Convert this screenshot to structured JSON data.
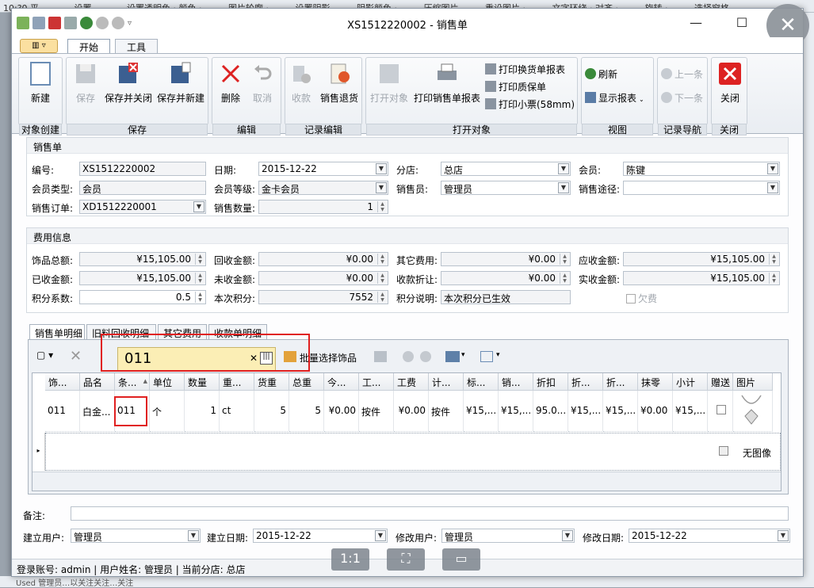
{
  "bg": {
    "strip": [
      "10:?0 平…",
      "设置…",
      "设置透明色 · 颜色 ·",
      "图片轮廓 ·",
      "设置阴影",
      "阴影颜色 ·",
      "压缩图片",
      "重设图片 ·",
      "文字环绕 · 对齐 ·",
      "旋转 ·",
      "选择窗格"
    ],
    "bottom": "Used  管理员…以关注关注…关注"
  },
  "window": {
    "title": "XS1512220002 - 销售单",
    "min": "—",
    "max": "☐",
    "close": "✕"
  },
  "ribbon": {
    "file_label": "▥ ▿",
    "tabs": [
      "开始",
      "工具"
    ],
    "groups": {
      "create": "对象创建",
      "save": "保存",
      "edit": "编辑",
      "record": "记录编辑",
      "open": "打开对象",
      "view": "视图",
      "nav": "记录导航",
      "close": "关闭"
    },
    "buttons": {
      "new": "新建",
      "save": "保存",
      "save_close": "保存并关闭",
      "save_new": "保存并新建",
      "delete": "删除",
      "cancel": "取消",
      "receive": "收款",
      "return": "销售退货",
      "open_obj": "打开对象",
      "print_report": "打印销售单报表",
      "print_exchange": "打印换货单报表",
      "print_quality": "打印质保单",
      "print_ticket": "打印小票(58mm)",
      "refresh": "刷新",
      "show_report": "显示报表",
      "prev": "上一条",
      "next": "下一条",
      "close": "关闭"
    }
  },
  "sales": {
    "heading": "销售单",
    "labels": {
      "no": "编号:",
      "date": "日期:",
      "branch": "分店:",
      "member": "会员:",
      "member_type": "会员类型:",
      "member_level": "会员等级:",
      "seller": "销售员:",
      "channel": "销售途径:",
      "order": "销售订单:",
      "qty": "销售数量:"
    },
    "values": {
      "no": "XS1512220002",
      "date": "2015-12-22",
      "branch": "总店",
      "member": "陈键",
      "member_type": "会员",
      "member_level": "金卡会员",
      "seller": "管理员",
      "channel": "",
      "order": "XD1512220001",
      "qty": "1"
    }
  },
  "fee": {
    "heading": "费用信息",
    "labels": {
      "total": "饰品总额:",
      "recycle": "回收金额:",
      "other": "其它费用:",
      "due": "应收金额:",
      "received": "已收金额:",
      "unreceived": "未收金额:",
      "discount": "收款折让:",
      "actual": "实收金额:",
      "factor": "积分系数:",
      "points": "本次积分:",
      "points_note": "积分说明:",
      "owe": "欠费"
    },
    "values": {
      "total": "¥15,105.00",
      "recycle": "¥0.00",
      "other": "¥0.00",
      "due": "¥15,105.00",
      "received": "¥15,105.00",
      "unreceived": "¥0.00",
      "discount": "¥0.00",
      "actual": "¥15,105.00",
      "factor": "0.5",
      "points": "7552",
      "points_note": "本次积分已生效"
    }
  },
  "detail_tabs": [
    "销售单明细",
    "旧料回收明细",
    "其它费用",
    "收款单明细"
  ],
  "toolbar": {
    "search": "011",
    "batch": "批量选择饰品"
  },
  "grid": {
    "headers": [
      "饰...",
      "品名",
      "条...",
      "单位",
      "数量",
      "重...",
      "货重",
      "总重",
      "今...",
      "工...",
      "工费",
      "计...",
      "标...",
      "销...",
      "折扣",
      "折...",
      "折...",
      "抹零",
      "小计",
      "赠送",
      "图片"
    ],
    "row": [
      "011",
      "白金...",
      "011",
      "个",
      "1",
      "ct",
      "5",
      "5",
      "¥0.00",
      "按件",
      "¥0.00",
      "按件",
      "¥15,...",
      "¥15,...",
      "95.0...",
      "¥15,...",
      "¥15,...",
      "¥0.00",
      "¥15,..."
    ],
    "no_image": "无图像"
  },
  "footer": {
    "note_label": "备注:",
    "note": "",
    "creator_label": "建立用户:",
    "creator": "管理员",
    "cdate_label": "建立日期:",
    "cdate": "2015-12-22",
    "modifier_label": "修改用户:",
    "modifier": "管理员",
    "mdate_label": "修改日期:",
    "mdate": "2015-12-22"
  },
  "status": "登录账号: admin  |  用户姓名: 管理员  |  当前分店: 总店"
}
